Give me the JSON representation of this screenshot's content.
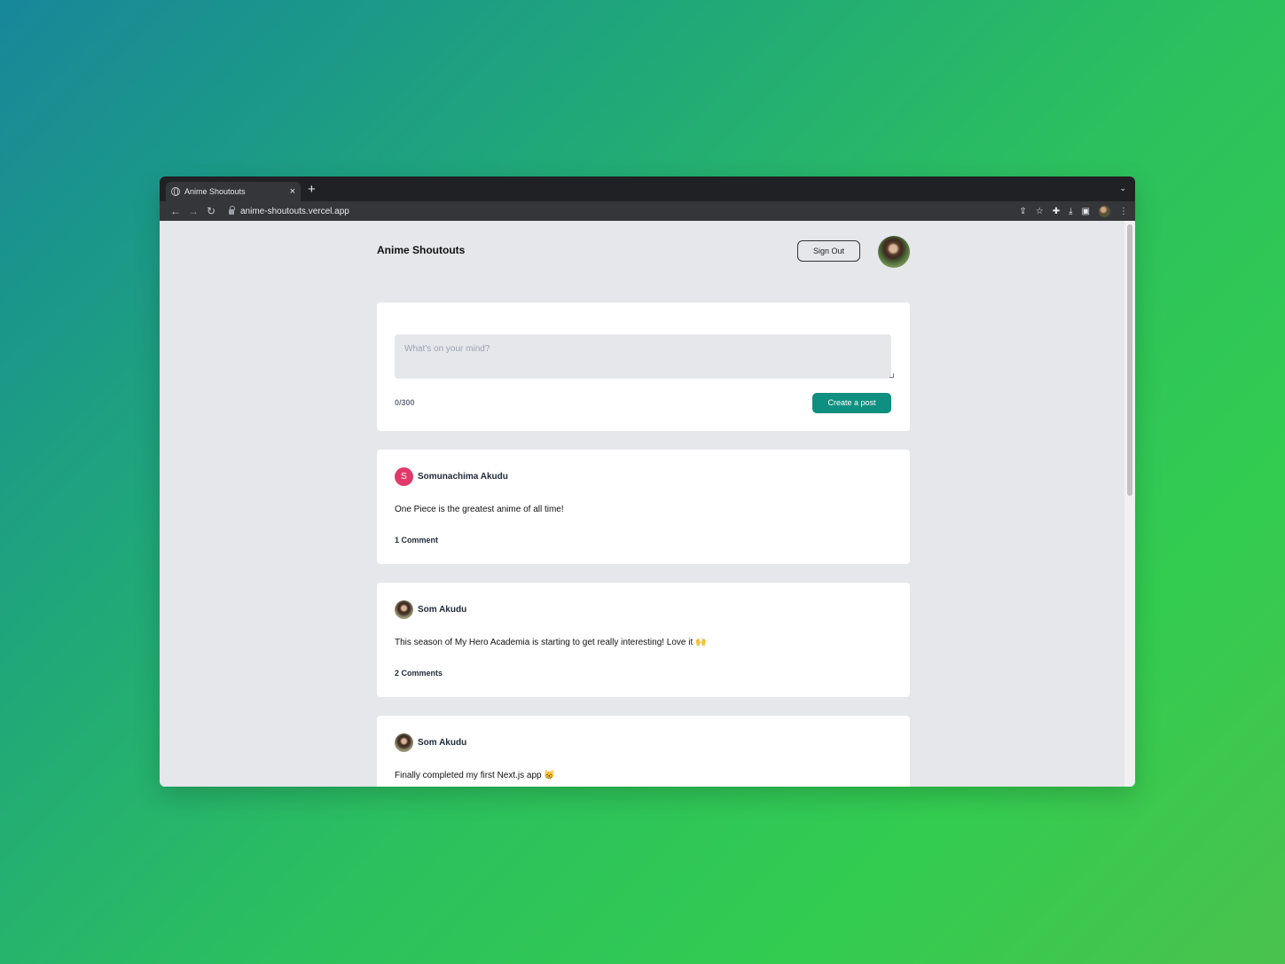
{
  "browser": {
    "tab_title": "Anime Shoutouts",
    "tab_close": "×",
    "new_tab": "+",
    "tab_menu": "⌄",
    "url": "anime-shoutouts.vercel.app",
    "icons": [
      "globe-icon",
      "back-icon",
      "forward-icon",
      "reload-icon",
      "lock-icon",
      "share-icon",
      "star-icon",
      "extensions-icon",
      "download-icon",
      "sidepanel-icon",
      "profile-avatar",
      "menu-icon"
    ]
  },
  "header": {
    "brand": "Anime Shoutouts",
    "signout_label": "Sign Out"
  },
  "composer": {
    "placeholder": "What's on your mind?",
    "counter": "0/300",
    "submit_label": "Create a post"
  },
  "posts": [
    {
      "avatar_letter": "S",
      "avatar_color": "#e03a6a",
      "author": "Somunachima Akudu",
      "body": "One Piece is the greatest anime of all time!",
      "comments": "1 Comment"
    },
    {
      "author": "Som Akudu",
      "body": "This season of My Hero Academia is starting to get really interesting! Love it 🙌",
      "comments": "2 Comments"
    },
    {
      "author": "Som Akudu",
      "body": "Finally completed my first Next.js app 😸",
      "comments": ""
    }
  ],
  "colors": {
    "accent": "#0f8f80",
    "page_bg": "#e5e7eb"
  }
}
